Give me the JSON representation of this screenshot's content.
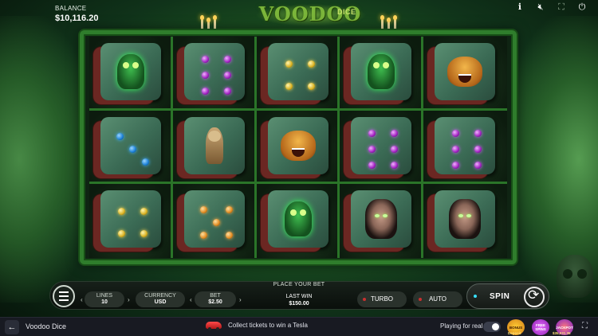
{
  "header": {
    "balance_label": "BALANCE",
    "balance_value": "$10,116.20",
    "logo_word": "VOODOO",
    "logo_suffix": "DICE",
    "icons": [
      "info-icon",
      "mute-icon",
      "fullscreen-icon",
      "power-icon"
    ]
  },
  "reels": [
    [
      {
        "type": "owl"
      },
      {
        "type": "die",
        "pips": 6,
        "color": "purple"
      },
      {
        "type": "die",
        "pips": 4,
        "color": "yellow"
      },
      {
        "type": "owl"
      },
      {
        "type": "bear"
      }
    ],
    [
      {
        "type": "die",
        "pips": 3,
        "color": "blue"
      },
      {
        "type": "doll"
      },
      {
        "type": "bear"
      },
      {
        "type": "die",
        "pips": 6,
        "color": "purple"
      },
      {
        "type": "die",
        "pips": 6,
        "color": "purple"
      }
    ],
    [
      {
        "type": "die",
        "pips": 4,
        "color": "yellow"
      },
      {
        "type": "die",
        "pips": 5,
        "color": "orange"
      },
      {
        "type": "owl"
      },
      {
        "type": "woman"
      },
      {
        "type": "woman"
      }
    ]
  ],
  "controls": {
    "place_bet": "PLACE YOUR BET",
    "lines_label": "LINES",
    "lines_value": "10",
    "currency_label": "CURRENCY",
    "currency_value": "USD",
    "bet_label": "BET",
    "bet_value": "$2.50",
    "last_win_label": "LAST WIN",
    "last_win_value": "$150.00",
    "turbo_label": "TURBO",
    "auto_label": "AUTO",
    "spin_label": "SPIN"
  },
  "footer": {
    "game_name": "Voodoo Dice",
    "promo_text": "Collect tickets to win a Tesla",
    "play_real_label": "Playing for real",
    "bonus_badge": "BONUS",
    "bonus_caption": "Deposit",
    "free_badge": "FREE SPINS",
    "jackpot_badge": "JACKPOT",
    "jackpot_value": "$35,031.35"
  }
}
